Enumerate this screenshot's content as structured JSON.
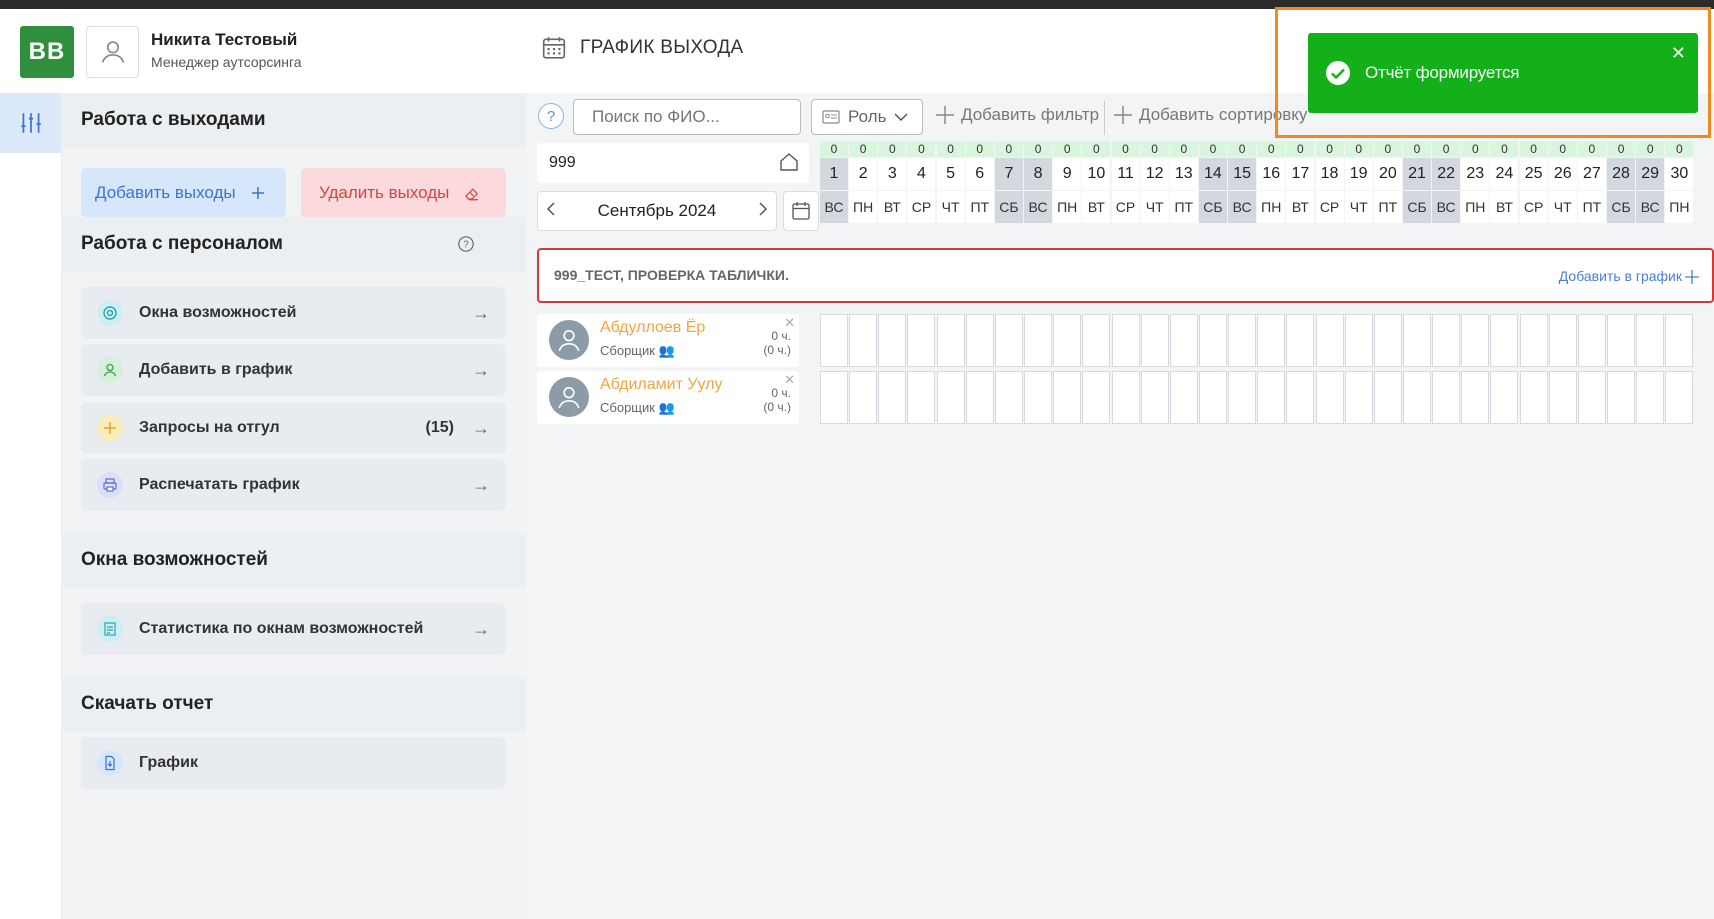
{
  "header": {
    "logo": "BB",
    "user_name": "Никита Тестовый",
    "user_role": "Менеджер аутсорсинга",
    "page_title": "ГРАФИК ВЫХОДА"
  },
  "sidebar": {
    "work_exits": {
      "title": "Работа с выходами",
      "add_label": "Добавить выходы",
      "delete_label": "Удалить выходы"
    },
    "staff": {
      "title": "Работа с персоналом",
      "items": [
        {
          "label": "Окна возможностей",
          "icon": "opportunity-icon",
          "count": ""
        },
        {
          "label": "Добавить в график",
          "icon": "user-icon",
          "count": ""
        },
        {
          "label": "Запросы на отгул",
          "icon": "plus-icon",
          "count": "(15)"
        },
        {
          "label": "Распечатать график",
          "icon": "printer-icon",
          "count": ""
        }
      ]
    },
    "windows": {
      "title": "Окна возможностей",
      "items": [
        {
          "label": "Статистика по окнам возможностей",
          "icon": "stats-icon"
        }
      ]
    },
    "report": {
      "title": "Скачать отчет",
      "items": [
        {
          "label": "График",
          "icon": "document-icon"
        }
      ]
    }
  },
  "toolbar": {
    "help": "?",
    "search_placeholder": "Поиск по ФИО...",
    "role_label": "Роль",
    "add_filter": "Добавить фильтр",
    "add_sort": "Добавить сортировку"
  },
  "filters": {
    "code": "999",
    "month": "Сентябрь 2024"
  },
  "calendar": {
    "days": [
      {
        "n": "1",
        "d": "ВС",
        "c": "0",
        "we": true
      },
      {
        "n": "2",
        "d": "ПН",
        "c": "0",
        "we": false
      },
      {
        "n": "3",
        "d": "ВТ",
        "c": "0",
        "we": false
      },
      {
        "n": "4",
        "d": "СР",
        "c": "0",
        "we": false
      },
      {
        "n": "5",
        "d": "ЧТ",
        "c": "0",
        "we": false
      },
      {
        "n": "6",
        "d": "ПТ",
        "c": "0",
        "we": false
      },
      {
        "n": "7",
        "d": "СБ",
        "c": "0",
        "we": true
      },
      {
        "n": "8",
        "d": "ВС",
        "c": "0",
        "we": true
      },
      {
        "n": "9",
        "d": "ПН",
        "c": "0",
        "we": false
      },
      {
        "n": "10",
        "d": "ВТ",
        "c": "0",
        "we": false
      },
      {
        "n": "11",
        "d": "СР",
        "c": "0",
        "we": false
      },
      {
        "n": "12",
        "d": "ЧТ",
        "c": "0",
        "we": false
      },
      {
        "n": "13",
        "d": "ПТ",
        "c": "0",
        "we": false
      },
      {
        "n": "14",
        "d": "СБ",
        "c": "0",
        "we": true
      },
      {
        "n": "15",
        "d": "ВС",
        "c": "0",
        "we": true
      },
      {
        "n": "16",
        "d": "ПН",
        "c": "0",
        "we": false
      },
      {
        "n": "17",
        "d": "ВТ",
        "c": "0",
        "we": false
      },
      {
        "n": "18",
        "d": "СР",
        "c": "0",
        "we": false
      },
      {
        "n": "19",
        "d": "ЧТ",
        "c": "0",
        "we": false
      },
      {
        "n": "20",
        "d": "ПТ",
        "c": "0",
        "we": false
      },
      {
        "n": "21",
        "d": "СБ",
        "c": "0",
        "we": true
      },
      {
        "n": "22",
        "d": "ВС",
        "c": "0",
        "we": true
      },
      {
        "n": "23",
        "d": "ПН",
        "c": "0",
        "we": false
      },
      {
        "n": "24",
        "d": "ВТ",
        "c": "0",
        "we": false
      },
      {
        "n": "25",
        "d": "СР",
        "c": "0",
        "we": false
      },
      {
        "n": "26",
        "d": "ЧТ",
        "c": "0",
        "we": false
      },
      {
        "n": "27",
        "d": "ПТ",
        "c": "0",
        "we": false
      },
      {
        "n": "28",
        "d": "СБ",
        "c": "0",
        "we": true
      },
      {
        "n": "29",
        "d": "ВС",
        "c": "0",
        "we": true
      },
      {
        "n": "30",
        "d": "ПН",
        "c": "0",
        "we": false
      }
    ]
  },
  "group": {
    "name": "999_ТЕСТ, ПРОВЕРКА ТАБЛИЧКИ.",
    "add_label": "Добавить в график"
  },
  "employees": [
    {
      "name": "Абдуллоев Ёр",
      "role": "Сборщик",
      "hours": "0 ч.",
      "hours_total": "(0 ч.)"
    },
    {
      "name": "Абдиламит Уулу",
      "role": "Сборщик",
      "hours": "0 ч.",
      "hours_total": "(0 ч.)"
    }
  ],
  "toast": {
    "message": "Отчёт формируется",
    "close": "✕"
  },
  "colors": {
    "toast_bg": "#13b01a",
    "highlight_frame": "#f08a1c",
    "group_border": "#d13a3a",
    "employee_name": "#f0a541"
  }
}
